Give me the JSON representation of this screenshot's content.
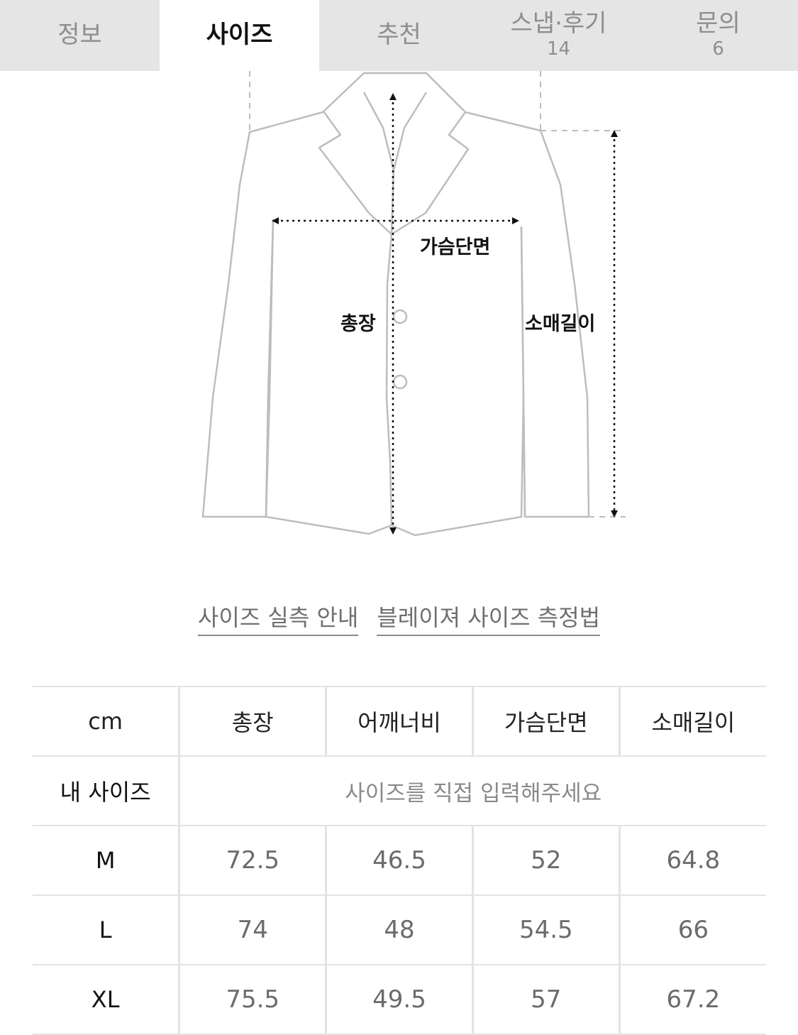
{
  "tabs": [
    {
      "label": "정보",
      "count": null,
      "active": false
    },
    {
      "label": "사이즈",
      "count": null,
      "active": true
    },
    {
      "label": "추천",
      "count": null,
      "active": false
    },
    {
      "label": "스냅·후기",
      "count": "14",
      "active": false
    },
    {
      "label": "문의",
      "count": "6",
      "active": false
    }
  ],
  "diagram": {
    "chest_label": "가슴단면",
    "length_label": "총장",
    "sleeve_label": "소매길이"
  },
  "links": {
    "size_guide": "사이즈 실측 안내",
    "measure_method": "블레이져 사이즈 측정법"
  },
  "table": {
    "headers": [
      "cm",
      "총장",
      "어깨너비",
      "가슴단면",
      "소매길이"
    ],
    "my_size": {
      "label": "내 사이즈",
      "placeholder": "사이즈를 직접 입력해주세요"
    },
    "rows": [
      {
        "size": "M",
        "values": [
          "72.5",
          "46.5",
          "52",
          "64.8"
        ]
      },
      {
        "size": "L",
        "values": [
          "74",
          "48",
          "54.5",
          "66"
        ]
      },
      {
        "size": "XL",
        "values": [
          "75.5",
          "49.5",
          "57",
          "67.2"
        ]
      }
    ]
  },
  "colors": {
    "tab_inactive_bg": "#e5e5e5",
    "outline": "#bdbdbd",
    "grid_line": "#e3e3e3",
    "value_text": "#6b6b6b"
  }
}
